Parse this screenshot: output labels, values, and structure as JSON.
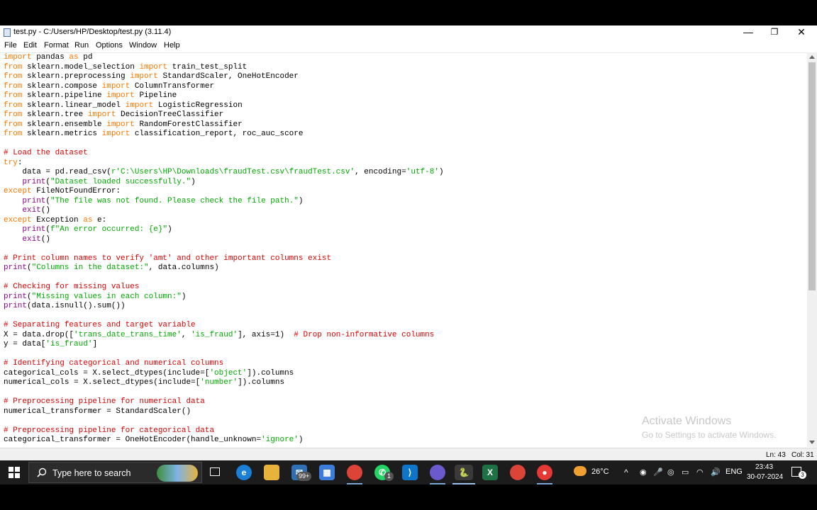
{
  "window": {
    "title": "test.py - C:/Users/HP/Desktop/test.py (3.11.4)",
    "minimize": "—",
    "maximize": "❐",
    "close": "✕"
  },
  "menu": [
    "File",
    "Edit",
    "Format",
    "Run",
    "Options",
    "Window",
    "Help"
  ],
  "code_lines": [
    [
      [
        "kw",
        "import"
      ],
      [
        "t",
        " pandas "
      ],
      [
        "kw",
        "as"
      ],
      [
        "t",
        " pd"
      ]
    ],
    [
      [
        "kw",
        "from"
      ],
      [
        "t",
        " sklearn.model_selection "
      ],
      [
        "kw",
        "import"
      ],
      [
        "t",
        " train_test_split"
      ]
    ],
    [
      [
        "kw",
        "from"
      ],
      [
        "t",
        " sklearn.preprocessing "
      ],
      [
        "kw",
        "import"
      ],
      [
        "t",
        " StandardScaler, OneHotEncoder"
      ]
    ],
    [
      [
        "kw",
        "from"
      ],
      [
        "t",
        " sklearn.compose "
      ],
      [
        "kw",
        "import"
      ],
      [
        "t",
        " ColumnTransformer"
      ]
    ],
    [
      [
        "kw",
        "from"
      ],
      [
        "t",
        " sklearn.pipeline "
      ],
      [
        "kw",
        "import"
      ],
      [
        "t",
        " Pipeline"
      ]
    ],
    [
      [
        "kw",
        "from"
      ],
      [
        "t",
        " sklearn.linear_model "
      ],
      [
        "kw",
        "import"
      ],
      [
        "t",
        " LogisticRegression"
      ]
    ],
    [
      [
        "kw",
        "from"
      ],
      [
        "t",
        " sklearn.tree "
      ],
      [
        "kw",
        "import"
      ],
      [
        "t",
        " DecisionTreeClassifier"
      ]
    ],
    [
      [
        "kw",
        "from"
      ],
      [
        "t",
        " sklearn.ensemble "
      ],
      [
        "kw",
        "import"
      ],
      [
        "t",
        " RandomForestClassifier"
      ]
    ],
    [
      [
        "kw",
        "from"
      ],
      [
        "t",
        " sklearn.metrics "
      ],
      [
        "kw",
        "import"
      ],
      [
        "t",
        " classification_report, roc_auc_score"
      ]
    ],
    [],
    [
      [
        "cm",
        "# Load the dataset"
      ]
    ],
    [
      [
        "kw",
        "try"
      ],
      [
        "t",
        ":"
      ]
    ],
    [
      [
        "t",
        "    data = pd.read_csv("
      ],
      [
        "str",
        "r'C:\\Users\\HP\\Downloads\\fraudTest.csv\\fraudTest.csv'"
      ],
      [
        "t",
        ", encoding="
      ],
      [
        "str",
        "'utf-8'"
      ],
      [
        "t",
        ")"
      ]
    ],
    [
      [
        "t",
        "    "
      ],
      [
        "bi",
        "print"
      ],
      [
        "t",
        "("
      ],
      [
        "str",
        "\"Dataset loaded successfully.\""
      ],
      [
        "t",
        ")"
      ]
    ],
    [
      [
        "kw",
        "except"
      ],
      [
        "t",
        " FileNotFoundError:"
      ]
    ],
    [
      [
        "t",
        "    "
      ],
      [
        "bi",
        "print"
      ],
      [
        "t",
        "("
      ],
      [
        "str",
        "\"The file was not found. Please check the file path.\""
      ],
      [
        "t",
        ")"
      ]
    ],
    [
      [
        "t",
        "    "
      ],
      [
        "bi",
        "exit"
      ],
      [
        "t",
        "()"
      ]
    ],
    [
      [
        "kw",
        "except"
      ],
      [
        "t",
        " Exception "
      ],
      [
        "kw",
        "as"
      ],
      [
        "t",
        " e:"
      ]
    ],
    [
      [
        "t",
        "    "
      ],
      [
        "bi",
        "print"
      ],
      [
        "t",
        "("
      ],
      [
        "str",
        "f\"An error occurred: {e}\""
      ],
      [
        "t",
        ")"
      ]
    ],
    [
      [
        "t",
        "    "
      ],
      [
        "bi",
        "exit"
      ],
      [
        "t",
        "()"
      ]
    ],
    [],
    [
      [
        "cm",
        "# Print column names to verify 'amt' and other important columns exist"
      ]
    ],
    [
      [
        "bi",
        "print"
      ],
      [
        "t",
        "("
      ],
      [
        "str",
        "\"Columns in the dataset:\""
      ],
      [
        "t",
        ", data.columns)"
      ]
    ],
    [],
    [
      [
        "cm",
        "# Checking for missing values"
      ]
    ],
    [
      [
        "bi",
        "print"
      ],
      [
        "t",
        "("
      ],
      [
        "str",
        "\"Missing values in each column:\""
      ],
      [
        "t",
        ")"
      ]
    ],
    [
      [
        "bi",
        "print"
      ],
      [
        "t",
        "(data.isnull().sum())"
      ]
    ],
    [],
    [
      [
        "cm",
        "# Separating features and target variable"
      ]
    ],
    [
      [
        "t",
        "X = data.drop(["
      ],
      [
        "str",
        "'trans_date_trans_time'"
      ],
      [
        "t",
        ", "
      ],
      [
        "str",
        "'is_fraud'"
      ],
      [
        "t",
        "], axis=1)  "
      ],
      [
        "cm",
        "# Drop non-informative columns"
      ]
    ],
    [
      [
        "t",
        "y = data["
      ],
      [
        "str",
        "'is_fraud'"
      ],
      [
        "t",
        "]"
      ]
    ],
    [],
    [
      [
        "cm",
        "# Identifying categorical and numerical columns"
      ]
    ],
    [
      [
        "t",
        "categorical_cols = X.select_dtypes(include=["
      ],
      [
        "str",
        "'object'"
      ],
      [
        "t",
        "]).columns"
      ]
    ],
    [
      [
        "t",
        "numerical_cols = X.select_dtypes(include=["
      ],
      [
        "str",
        "'number'"
      ],
      [
        "t",
        "]).columns"
      ]
    ],
    [],
    [
      [
        "cm",
        "# Preprocessing pipeline for numerical data"
      ]
    ],
    [
      [
        "t",
        "numerical_transformer = StandardScaler()"
      ]
    ],
    [],
    [
      [
        "cm",
        "# Preprocessing pipeline for categorical data"
      ]
    ],
    [
      [
        "t",
        "categorical_transformer = OneHotEncoder(handle_unknown="
      ],
      [
        "str",
        "'ignore'"
      ],
      [
        "t",
        ")"
      ]
    ]
  ],
  "status": {
    "line": "Ln: 43",
    "col": "Col: 31"
  },
  "watermark": {
    "title": "Activate Windows",
    "subtitle": "Go to Settings to activate Windows."
  },
  "taskbar": {
    "search_placeholder": "Type here to search",
    "mail_badge": "99+",
    "whatsapp_badge": "1",
    "weather": "26°C",
    "language": "ENG",
    "time": "23:43",
    "date": "30-07-2024",
    "notification_count": "3"
  },
  "colors": {
    "keyword": "#ff7700",
    "builtin": "#900090",
    "string": "#00aa00",
    "comment": "#dd0000"
  }
}
